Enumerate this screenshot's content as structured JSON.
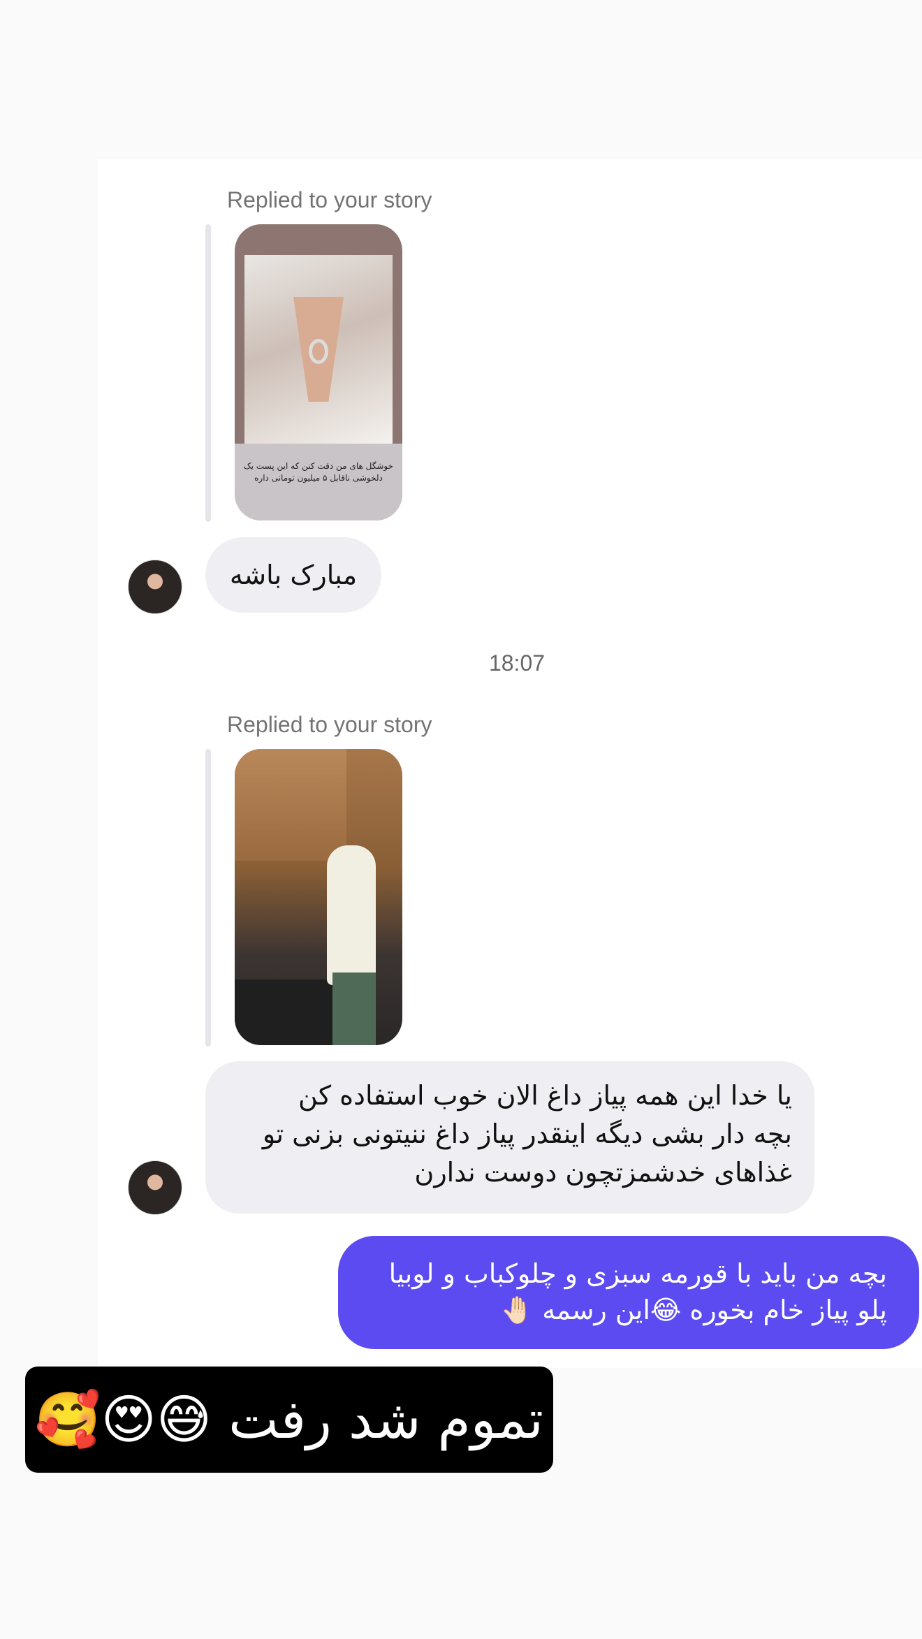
{
  "messages": [
    {
      "reply_label": "Replied to your story",
      "story_caption": "خوشگل های من دقت کنن که این پست یک دلخوشی ناقابل ۵ میلیون تومانی داره",
      "text": "مبارک باشه"
    },
    {
      "reply_label": "Replied to your story",
      "text": "یا خدا این همه پیاز داغ الان خوب استفاده کن\nبچه دار بشی دیگه اینقدر پیاز داغ ننیتونی بزنی تو\nغذاهای خدشمزتچون دوست ندارن"
    }
  ],
  "timestamp": "18:07",
  "outgoing": {
    "text": "بچه من باید با قورمه سبزی و چلوکباب و لوبیا\nپلو پیاز خام بخوره 😂این رسمه 🤚🏻"
  },
  "overlay": {
    "caption": "تموم شد رفت 😅😍🥰"
  },
  "colors": {
    "outgoing_bubble": "#5b4bf0",
    "incoming_bubble": "#efeff3",
    "background": "#fafafa"
  }
}
